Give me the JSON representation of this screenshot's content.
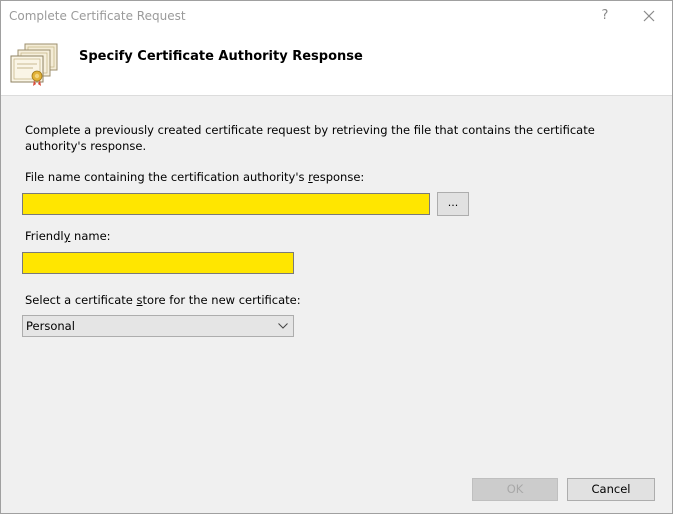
{
  "window": {
    "title": "Complete Certificate Request",
    "help_glyph": "?",
    "close_icon": "close-icon"
  },
  "header": {
    "title": "Specify Certificate Authority Response",
    "icon": "certificates-icon"
  },
  "description": "Complete a previously created certificate request by retrieving the file that contains the certificate authority's response.",
  "file_name": {
    "label_pre": "File name containing the certification authority's ",
    "label_access": "r",
    "label_post": "esponse:",
    "value": "",
    "highlight_color": "#ffe600"
  },
  "browse_button": {
    "label": "..."
  },
  "friendly_name": {
    "label_pre": "Friendl",
    "label_access": "y",
    "label_post": " name:",
    "value": ""
  },
  "cert_store": {
    "label_pre": "Select a certificate ",
    "label_access": "s",
    "label_post": "tore for the new certificate:",
    "selected": "Personal",
    "icon": "chevron-down-icon"
  },
  "buttons": {
    "ok_label": "OK",
    "ok_enabled": false,
    "cancel_label": "Cancel"
  }
}
